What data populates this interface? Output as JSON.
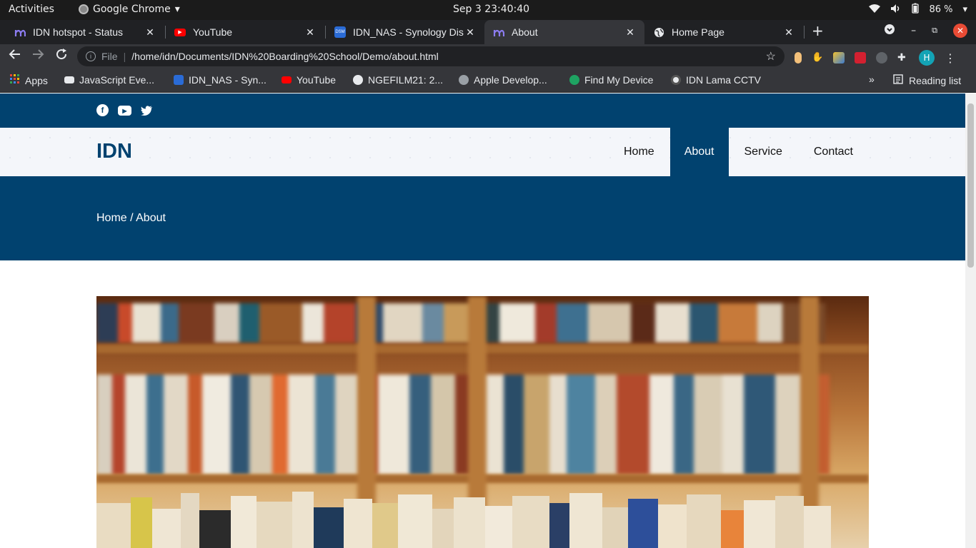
{
  "system": {
    "activities": "Activities",
    "app_name": "Google Chrome",
    "clock": "Sep 3  23:40:40",
    "battery": "86 %"
  },
  "tabs": [
    {
      "title": "IDN hotspot - Status",
      "favicon": "hotspot-icon",
      "active": false
    },
    {
      "title": "YouTube",
      "favicon": "youtube-icon",
      "active": false
    },
    {
      "title": "IDN_NAS - Synology Dis",
      "favicon": "dsm-icon",
      "active": false
    },
    {
      "title": "About",
      "favicon": "hotspot-icon",
      "active": true
    },
    {
      "title": "Home Page",
      "favicon": "globe-icon",
      "active": false
    }
  ],
  "omnibox": {
    "scheme_label": "File",
    "url": "/home/idn/Documents/IDN%20Boarding%20School/Demo/about.html"
  },
  "profile_initial": "H",
  "bookmarks": [
    {
      "label": "Apps",
      "icon": "apps-grid-icon"
    },
    {
      "label": "JavaScript Eve...",
      "icon": "page-icon"
    },
    {
      "label": "IDN_NAS - Syn...",
      "icon": "dsm-icon"
    },
    {
      "label": "YouTube",
      "icon": "youtube-icon"
    },
    {
      "label": "NGEFILM21: 2...",
      "icon": "globe-icon"
    },
    {
      "label": "Apple Develop...",
      "icon": "apple-icon"
    },
    {
      "label": "Find My Device",
      "icon": "find-device-icon"
    },
    {
      "label": "IDN Lama CCTV",
      "icon": "cctv-icon"
    }
  ],
  "bookmarks_more": "»",
  "reading_list": "Reading list",
  "site": {
    "brand": "IDN",
    "nav": [
      {
        "label": "Home",
        "active": false
      },
      {
        "label": "About",
        "active": true
      },
      {
        "label": "Service",
        "active": false
      },
      {
        "label": "Contact",
        "active": false
      }
    ],
    "breadcrumb": "Home / About",
    "brand_color": "#01426f"
  }
}
